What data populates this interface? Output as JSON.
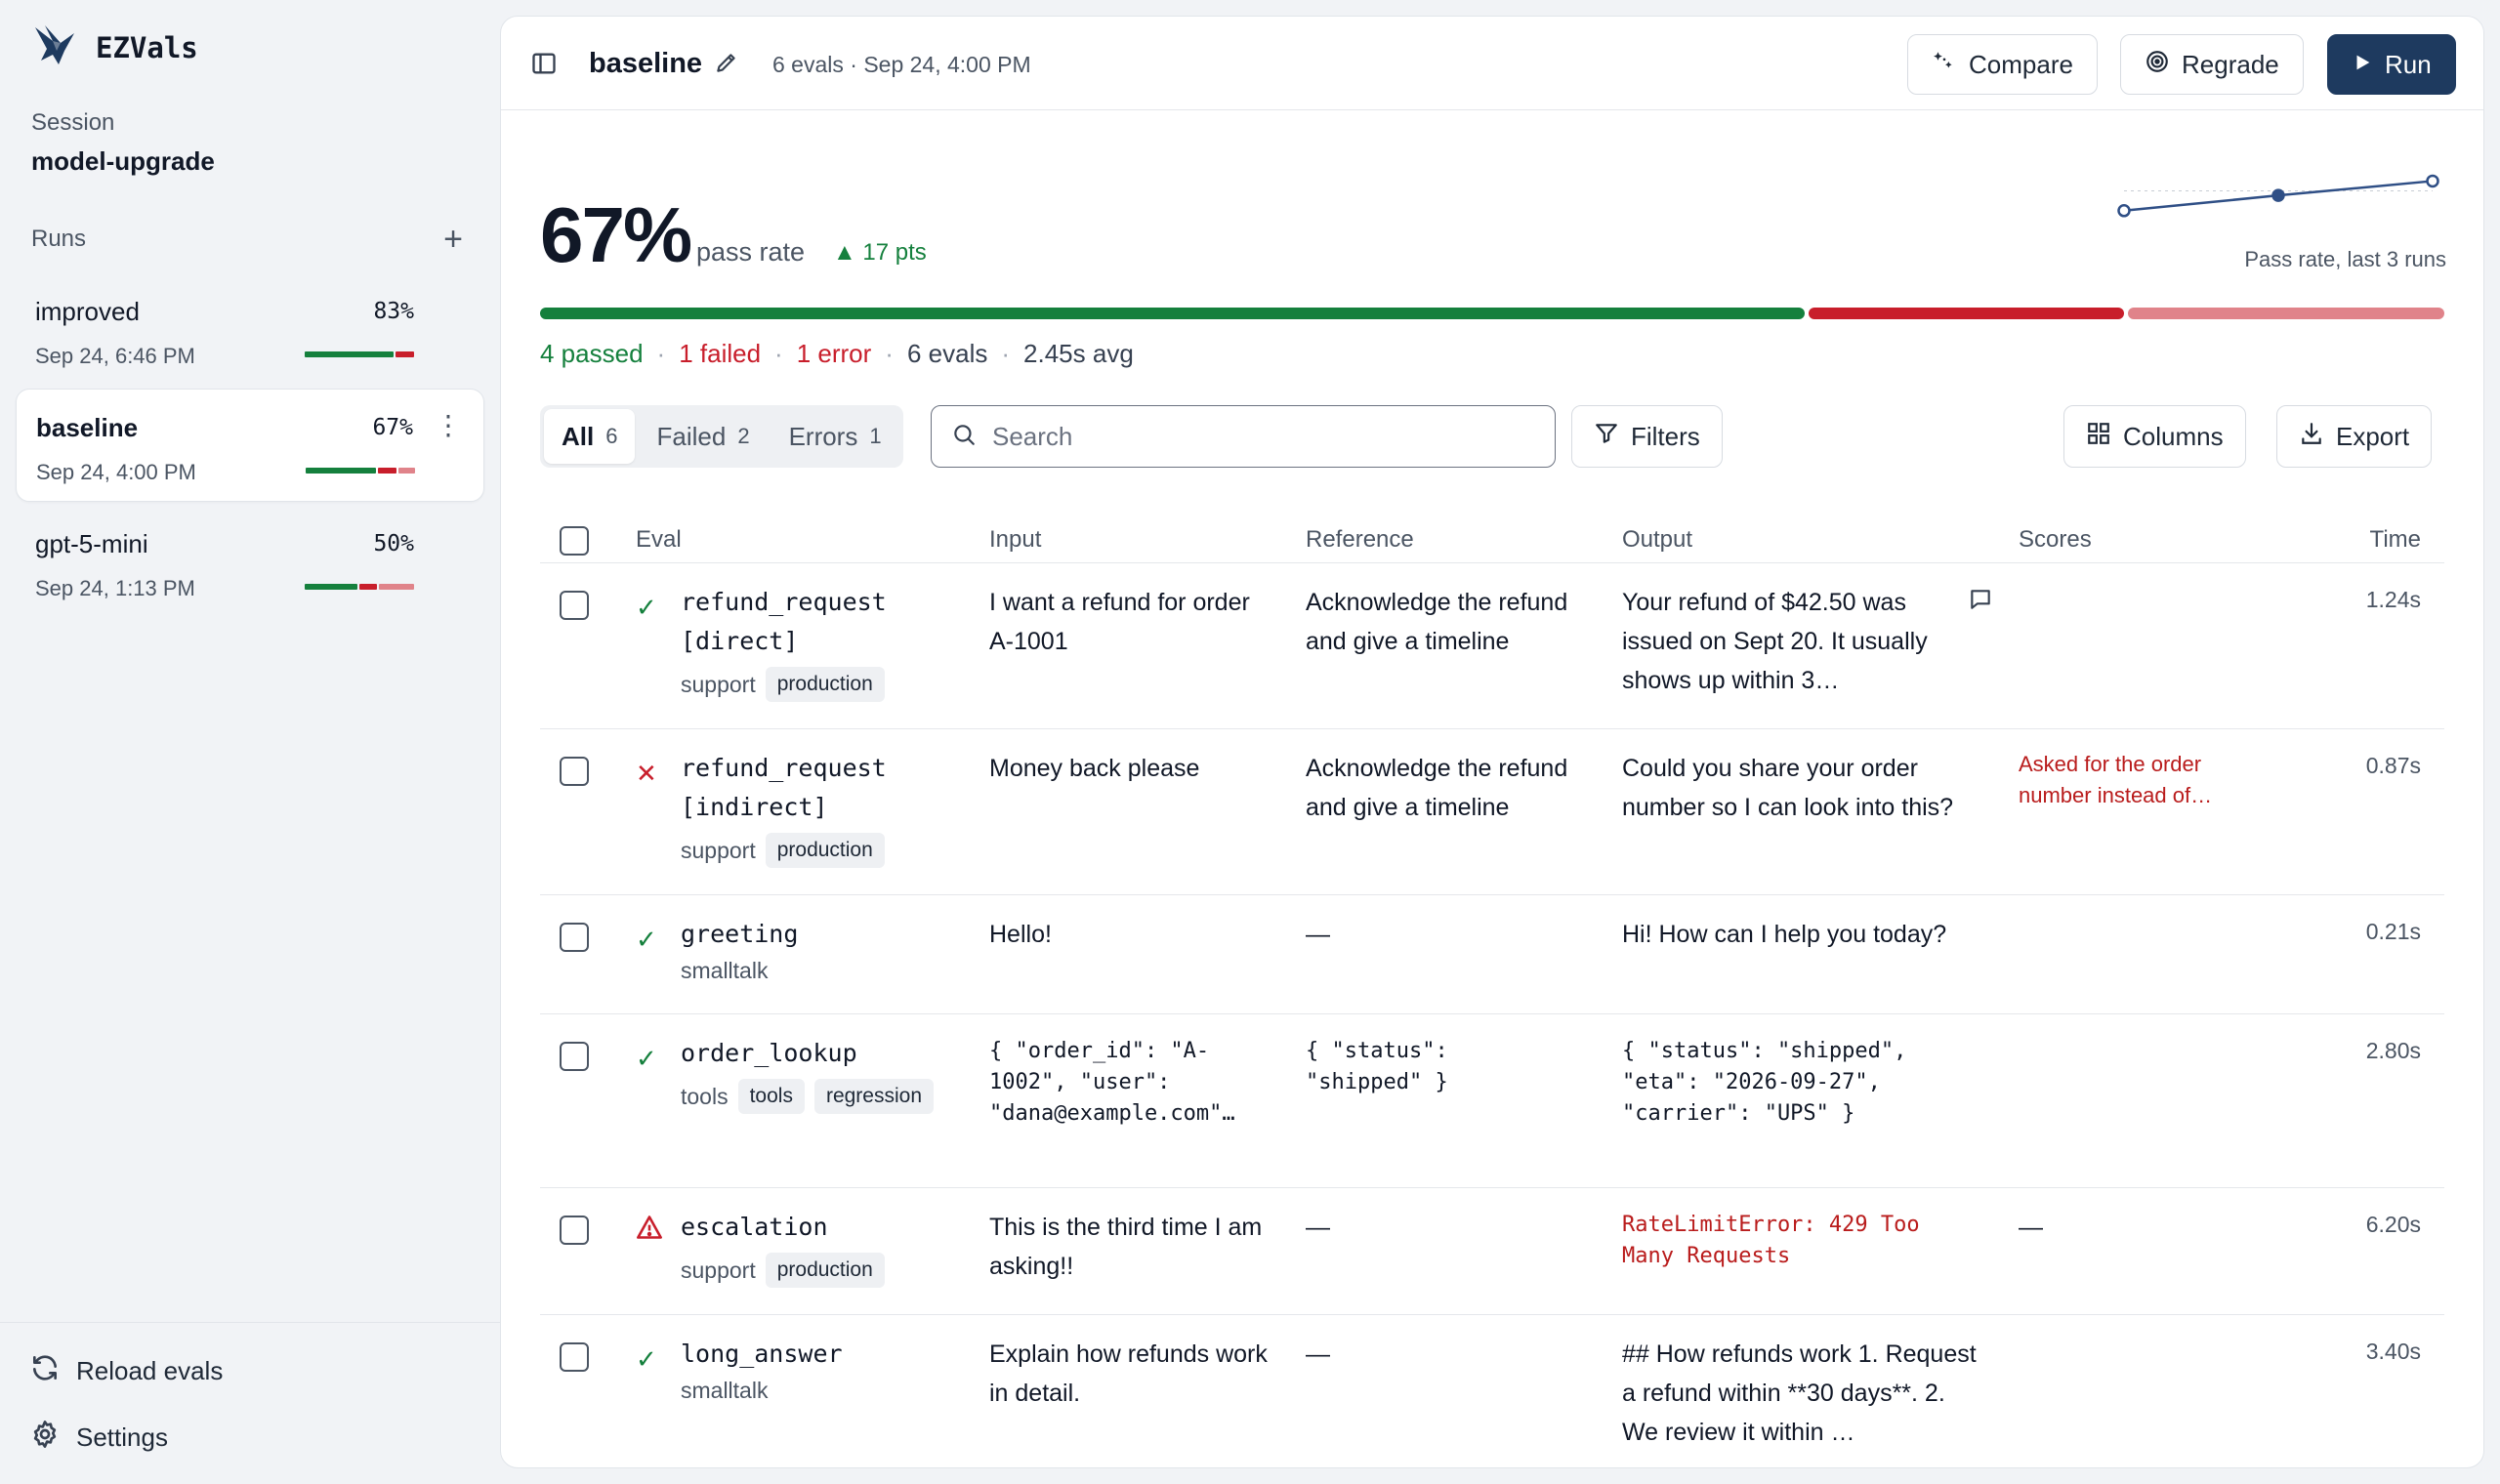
{
  "app": {
    "name": "EZVals"
  },
  "sidebar": {
    "session_label": "Session",
    "session_value": "model-upgrade",
    "runs_title": "Runs",
    "runs": [
      {
        "name": "improved",
        "pct": "83%",
        "date": "Sep 24, 6:46 PM",
        "bar": [
          0.83,
          0.17,
          0
        ]
      },
      {
        "name": "baseline",
        "pct": "67%",
        "date": "Sep 24, 4:00 PM",
        "bar": [
          0.67,
          0.17,
          0.16
        ]
      },
      {
        "name": "gpt-5-mini",
        "pct": "50%",
        "date": "Sep 24, 1:13 PM",
        "bar": [
          0.5,
          0.17,
          0.33
        ]
      }
    ],
    "footer": {
      "reload": "Reload evals",
      "settings": "Settings"
    }
  },
  "header": {
    "title": "baseline",
    "meta": "6 evals · Sep 24, 4:00 PM",
    "compare": "Compare",
    "regrade": "Regrade",
    "run": "Run"
  },
  "summary": {
    "pass_rate": "67%",
    "pass_label": "pass rate",
    "delta": "▲ 17 pts",
    "spark_caption": "Pass rate, last 3 runs",
    "spark_values": [
      0.5,
      0.67,
      0.83
    ],
    "progress": {
      "passed": 4,
      "failed": 1,
      "error": 1
    },
    "passed": "4 passed",
    "failed": "1 failed",
    "error": "1 error",
    "evals": "6 evals",
    "avg": "2.45s avg"
  },
  "filters": {
    "tabs": [
      {
        "label": "All",
        "count": "6"
      },
      {
        "label": "Failed",
        "count": "2"
      },
      {
        "label": "Errors",
        "count": "1"
      }
    ],
    "search_placeholder": "Search",
    "filters_label": "Filters",
    "columns_label": "Columns",
    "export_label": "Export"
  },
  "table": {
    "columns": [
      "Eval",
      "Input",
      "Reference",
      "Output",
      "Scores",
      "Time"
    ],
    "rows": [
      {
        "status": "pass",
        "name_lines": [
          "refund_request",
          "[direct]"
        ],
        "tags": [
          {
            "text": "support",
            "pill": false
          },
          {
            "text": "production",
            "pill": true
          }
        ],
        "input": "I want a refund for order A-1001",
        "reference": "Acknowledge the refund and give a timeline",
        "output": "Your refund of $42.50 was issued on Sept 20. It usually shows up within 3…",
        "score": "",
        "time": "1.24s"
      },
      {
        "status": "fail",
        "name_lines": [
          "refund_request",
          "[indirect]"
        ],
        "tags": [
          {
            "text": "support",
            "pill": false
          },
          {
            "text": "production",
            "pill": true
          }
        ],
        "input": "Money back please",
        "reference": "Acknowledge the refund and give a timeline",
        "output": "Could you share your order number so I can look into this?",
        "score": "Asked for the order number instead of…",
        "time": "0.87s"
      },
      {
        "status": "pass",
        "name_lines": [
          "greeting"
        ],
        "tags": [
          {
            "text": "smalltalk",
            "pill": false
          }
        ],
        "input": "Hello!",
        "reference": "—",
        "output": "Hi! How can I help you today?",
        "score": "",
        "time": "0.21s"
      },
      {
        "status": "pass",
        "name_lines": [
          "order_lookup"
        ],
        "tags": [
          {
            "text": "tools",
            "pill": false
          },
          {
            "text": "tools",
            "pill": true
          },
          {
            "text": "regression",
            "pill": true
          }
        ],
        "input": "{ \"order_id\": \"A-1002\", \"user\": \"dana@example.com\"…",
        "reference": "{ \"status\": \"shipped\" }",
        "output": "{ \"status\": \"shipped\", \"eta\": \"2026-09-27\", \"carrier\": \"UPS\" }",
        "score": "",
        "time": "2.80s"
      },
      {
        "status": "error",
        "name_lines": [
          "escalation"
        ],
        "tags": [
          {
            "text": "support",
            "pill": false
          },
          {
            "text": "production",
            "pill": true
          }
        ],
        "input": "This is the third time I am asking!!",
        "reference": "—",
        "output": "RateLimitError: 429 Too Many Requests",
        "score": "—",
        "time": "6.20s"
      },
      {
        "status": "pass",
        "name_lines": [
          "long_answer"
        ],
        "tags": [
          {
            "text": "smalltalk",
            "pill": false
          }
        ],
        "input": "Explain how refunds work in detail.",
        "reference": "—",
        "output": "## How refunds work 1. Request a refund within **30 days**. 2. We review it within …",
        "score": "",
        "time": "3.40s"
      }
    ]
  },
  "colors": {
    "pass": "#15803d",
    "fail": "#c81e2b",
    "error_light": "#e0838a",
    "primary": "#1e3a5f",
    "spark": "#2f4f86"
  }
}
